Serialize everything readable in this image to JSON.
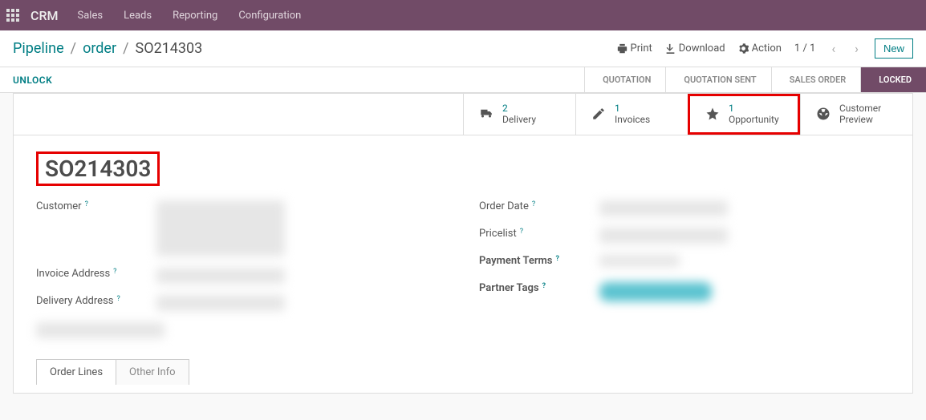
{
  "topbar": {
    "brand": "CRM",
    "nav": [
      "Sales",
      "Leads",
      "Reporting",
      "Configuration"
    ]
  },
  "breadcrumb": {
    "root": "Pipeline",
    "mid": "order",
    "current": "SO214303"
  },
  "header_actions": {
    "print": "Print",
    "download": "Download",
    "action": "Action",
    "pager": "1 / 1",
    "new": "New"
  },
  "statusbar": {
    "unlock": "UNLOCK",
    "stages": [
      "QUOTATION",
      "QUOTATION SENT",
      "SALES ORDER",
      "LOCKED"
    ],
    "active_index": 3
  },
  "statboxes": [
    {
      "count": "2",
      "label": "Delivery",
      "icon": "truck"
    },
    {
      "count": "1",
      "label": "Invoices",
      "icon": "edit"
    },
    {
      "count": "1",
      "label": "Opportunity",
      "icon": "star",
      "highlight": true
    },
    {
      "count": "",
      "label1": "Customer",
      "label2": "Preview",
      "icon": "globe"
    }
  ],
  "record": {
    "name": "SO214303",
    "left_fields": [
      {
        "label": "Customer",
        "help": true,
        "blur": "tall"
      },
      {
        "label": "Invoice Address",
        "help": true,
        "blur": "med"
      },
      {
        "label": "Delivery Address",
        "help": true,
        "blur": "med"
      }
    ],
    "right_fields": [
      {
        "label": "Order Date",
        "help": true,
        "blur": "med"
      },
      {
        "label": "Pricelist",
        "help": true,
        "blur": "med"
      },
      {
        "label": "Payment Terms",
        "help": true,
        "bold": true,
        "blur": "sm"
      },
      {
        "label": "Partner Tags",
        "help": true,
        "bold": true,
        "tag": true
      }
    ]
  },
  "tabs": [
    "Order Lines",
    "Other Info"
  ]
}
